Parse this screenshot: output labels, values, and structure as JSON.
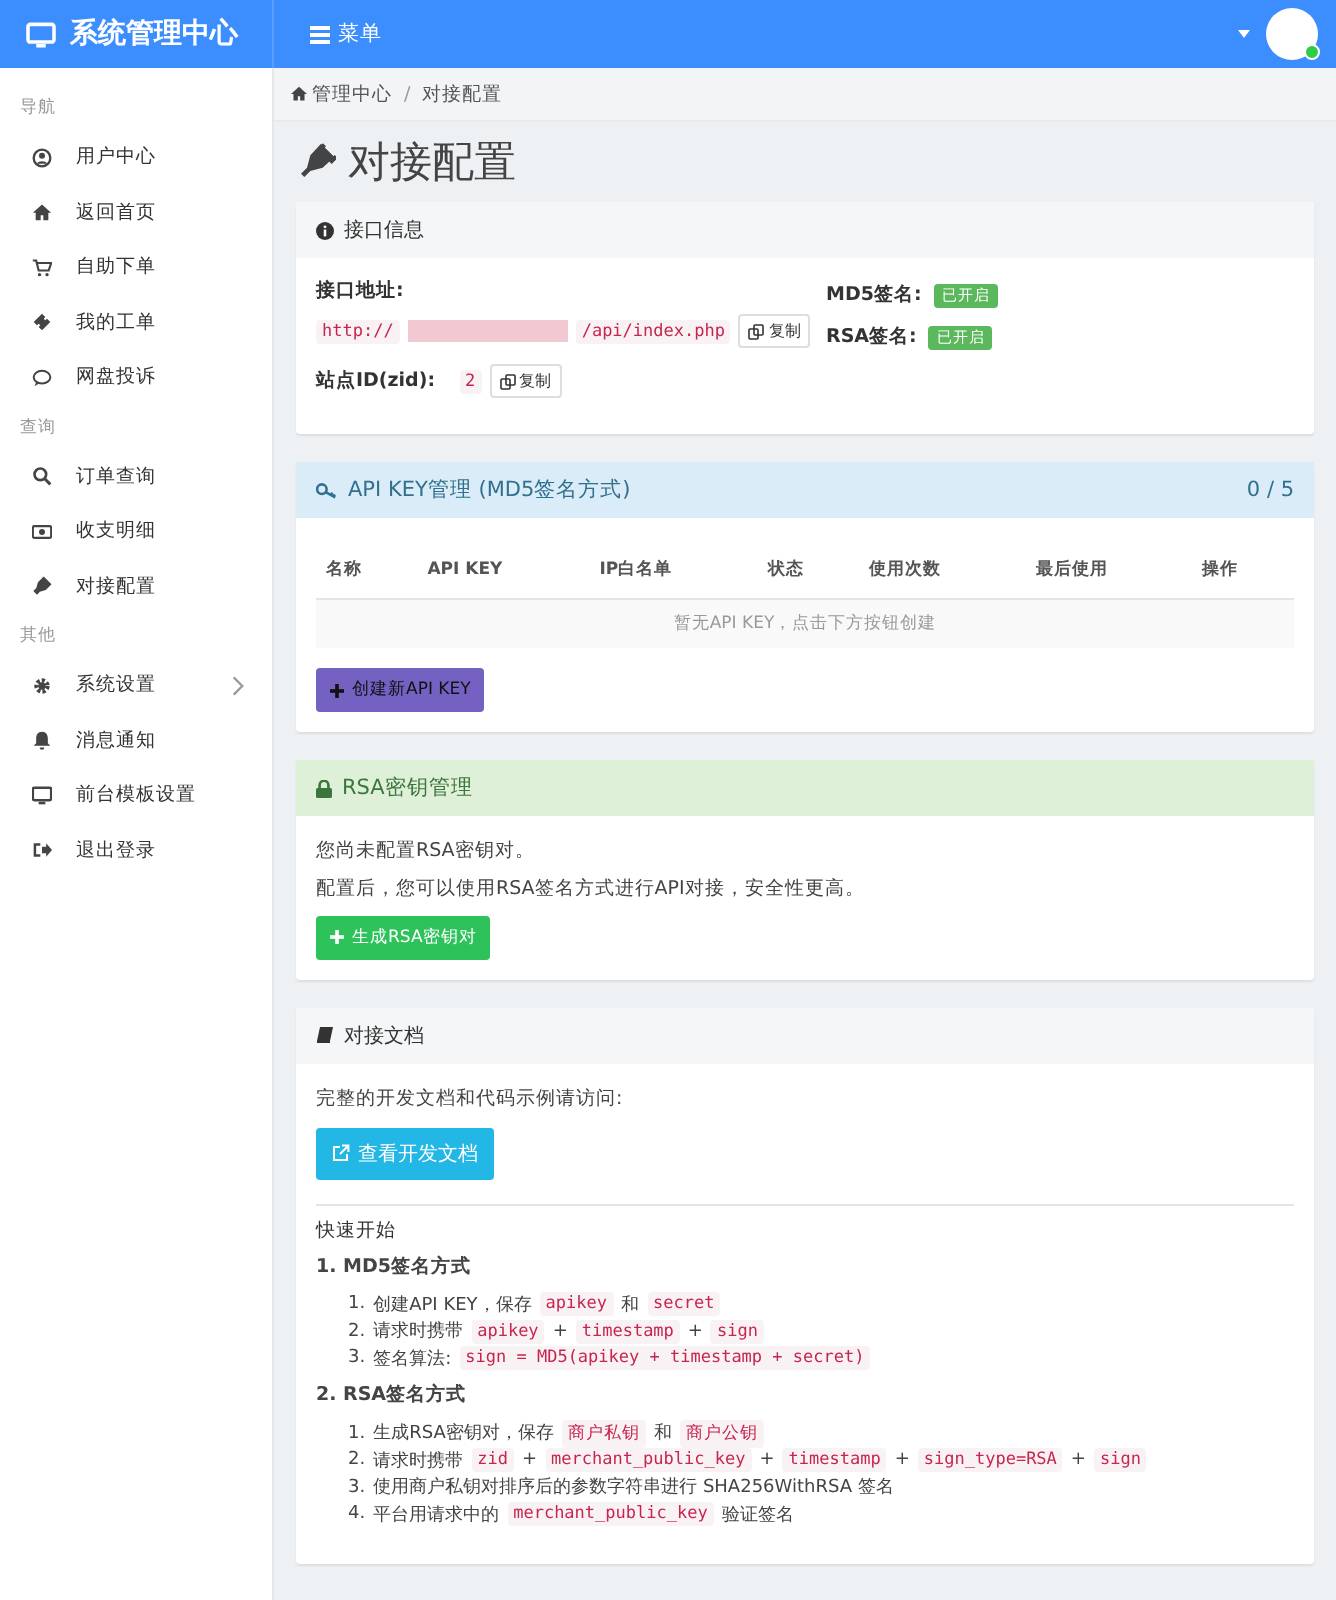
{
  "brand": {
    "title": "系统管理中心"
  },
  "topbar": {
    "menu_label": "菜单",
    "user": {
      "online": true
    }
  },
  "sidebar": {
    "sections": [
      {
        "label": "导航",
        "items": [
          {
            "label": "用户中心",
            "has_submenu": false
          },
          {
            "label": "返回首页",
            "has_submenu": false
          },
          {
            "label": "自助下单",
            "has_submenu": false
          },
          {
            "label": "我的工单",
            "has_submenu": false
          },
          {
            "label": "网盘投诉",
            "has_submenu": false
          }
        ]
      },
      {
        "label": "查询",
        "items": [
          {
            "label": "订单查询",
            "has_submenu": false
          },
          {
            "label": "收支明细",
            "has_submenu": false
          },
          {
            "label": "对接配置",
            "has_submenu": false
          }
        ]
      },
      {
        "label": "其他",
        "items": [
          {
            "label": "系统设置",
            "has_submenu": true
          },
          {
            "label": "消息通知",
            "has_submenu": false
          },
          {
            "label": "前台模板设置",
            "has_submenu": false
          },
          {
            "label": "退出登录",
            "has_submenu": false
          }
        ]
      }
    ]
  },
  "breadcrumb": [
    "管理中心",
    "对接配置"
  ],
  "breadcrumb_separator": "/",
  "page_title": "对接配置",
  "interface_card": {
    "title": "接口信息",
    "url_label": "接口地址:",
    "url_prefix": "http://",
    "url_suffix": "/api/index.php",
    "url_copy": "复制",
    "zid_label": "站点ID(zid):",
    "zid": "2",
    "zid_copy": "复制",
    "signatures": [
      {
        "label": "MD5签名:",
        "status": "已开启",
        "enabled": true
      },
      {
        "label": "RSA签名:",
        "status": "已开启",
        "enabled": true
      }
    ]
  },
  "api_key_card": {
    "title": "API KEY管理 (MD5签名方式)",
    "count": "0 / 5",
    "columns": [
      "名称",
      "API KEY",
      "IP白名单",
      "状态",
      "使用次数",
      "最后使用",
      "操作"
    ],
    "empty_text": "暂无API KEY，点击下方按钮创建",
    "create_button": "创建新API KEY"
  },
  "rsa_card": {
    "title": "RSA密钥管理",
    "paragraphs": [
      "您尚未配置RSA密钥对。",
      "配置后，您可以使用RSA签名方式进行API对接，安全性更高。"
    ],
    "generate_button": "生成RSA密钥对"
  },
  "docs_card": {
    "title": "对接文档",
    "intro": "完整的开发文档和代码示例请访问:",
    "docs_button": "查看开发文档",
    "quick_start": "快速开始",
    "sections": [
      {
        "heading": "1. MD5签名方式",
        "steps": [
          {
            "number": "1.",
            "parts": [
              {
                "kind": "text",
                "text": "创建API KEY，保存"
              },
              {
                "kind": "code",
                "text": "apikey"
              },
              {
                "kind": "text",
                "text": "和"
              },
              {
                "kind": "code",
                "text": "secret"
              }
            ]
          },
          {
            "number": "2.",
            "parts": [
              {
                "kind": "text",
                "text": "请求时携带"
              },
              {
                "kind": "code",
                "text": "apikey"
              },
              {
                "kind": "text",
                "text": "+"
              },
              {
                "kind": "code",
                "text": "timestamp"
              },
              {
                "kind": "text",
                "text": "+"
              },
              {
                "kind": "code",
                "text": "sign"
              }
            ]
          },
          {
            "number": "3.",
            "parts": [
              {
                "kind": "text",
                "text": "签名算法:"
              },
              {
                "kind": "code",
                "text": "sign = MD5(apikey + timestamp + secret)"
              }
            ]
          }
        ]
      },
      {
        "heading": "2. RSA签名方式",
        "steps": [
          {
            "number": "1.",
            "parts": [
              {
                "kind": "text",
                "text": "生成RSA密钥对，保存"
              },
              {
                "kind": "code",
                "text": "商户私钥"
              },
              {
                "kind": "text",
                "text": "和"
              },
              {
                "kind": "code",
                "text": "商户公钥"
              }
            ]
          },
          {
            "number": "2.",
            "parts": [
              {
                "kind": "text",
                "text": "请求时携带"
              },
              {
                "kind": "code",
                "text": "zid"
              },
              {
                "kind": "text",
                "text": "+"
              },
              {
                "kind": "code",
                "text": "merchant_public_key"
              },
              {
                "kind": "text",
                "text": "+"
              },
              {
                "kind": "code",
                "text": "timestamp"
              },
              {
                "kind": "text",
                "text": "+"
              },
              {
                "kind": "code",
                "text": "sign_type=RSA"
              },
              {
                "kind": "text",
                "text": "+"
              },
              {
                "kind": "code",
                "text": "sign"
              }
            ]
          },
          {
            "number": "3.",
            "parts": [
              {
                "kind": "text",
                "text": "使用商户私钥对排序后的参数字符串进行 SHA256WithRSA 签名"
              }
            ]
          },
          {
            "number": "4.",
            "parts": [
              {
                "kind": "text",
                "text": "平台用请求中的"
              },
              {
                "kind": "code",
                "text": "merchant_public_key"
              },
              {
                "kind": "text",
                "text": "验证签名"
              }
            ]
          }
        ]
      }
    ]
  }
}
